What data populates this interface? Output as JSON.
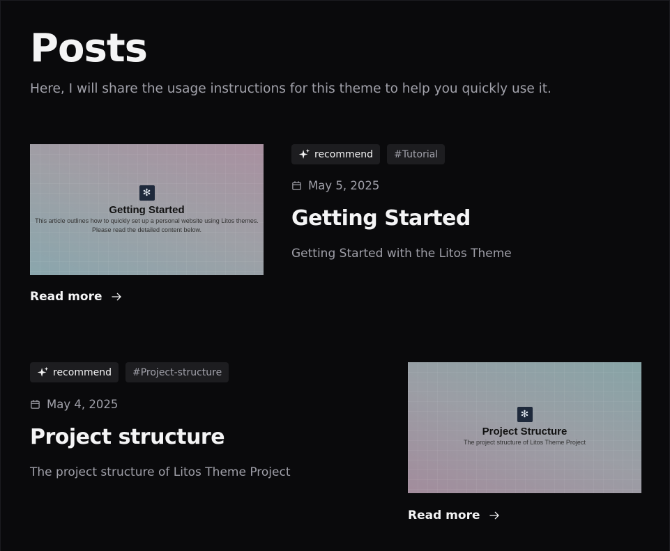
{
  "page": {
    "title": "Posts",
    "subtitle": "Here, I will share the usage instructions for this theme to help you quickly use it."
  },
  "posts": [
    {
      "tags": {
        "recommend": "recommend",
        "hash": "#Tutorial"
      },
      "date": "May 5, 2025",
      "title": "Getting Started",
      "description": "Getting Started with the Litos Theme",
      "read_more": "Read more",
      "thumbnail": {
        "logo_glyph": "✻",
        "title": "Getting Started",
        "description_line1": "This article outlines how to quickly set up a personal website using Litos themes.",
        "description_line2": "Please read the detailed content below."
      }
    },
    {
      "tags": {
        "recommend": "recommend",
        "hash": "#Project-structure"
      },
      "date": "May 4, 2025",
      "title": "Project structure",
      "description": "The project structure of Litos Theme Project",
      "read_more": "Read more",
      "thumbnail": {
        "logo_glyph": "✻",
        "title": "Project Structure",
        "description_line1": "The project structure of Litos Theme Project"
      }
    }
  ],
  "colors": {
    "background": "#0a0a0c",
    "tag_background": "#1d1d20",
    "muted_text": "#a1a1aa"
  },
  "icons": [
    "sparkles-icon",
    "calendar-icon",
    "arrow-right-icon"
  ]
}
